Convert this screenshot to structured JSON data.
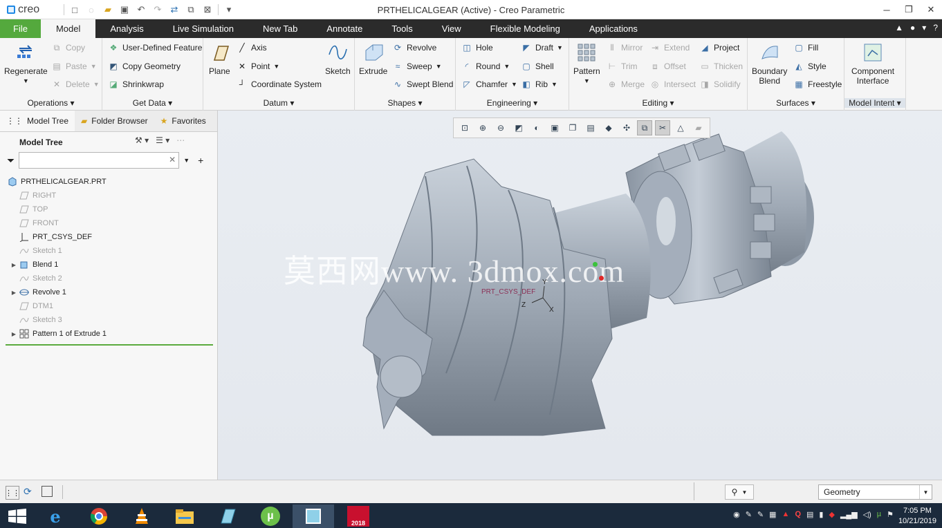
{
  "app": {
    "logo": "creo",
    "window_title": "PRTHELICALGEAR (Active) - Creo Parametric"
  },
  "menu": {
    "file": "File",
    "model": "Model",
    "analysis": "Analysis",
    "live_simulation": "Live Simulation",
    "new_tab": "New Tab",
    "annotate": "Annotate",
    "tools": "Tools",
    "view": "View",
    "flexible_modeling": "Flexible Modeling",
    "applications": "Applications"
  },
  "ribbon": {
    "operations": {
      "regenerate": "Regenerate",
      "copy": "Copy",
      "paste": "Paste",
      "delete": "Delete",
      "label": "Operations"
    },
    "get_data": {
      "udf": "User-Defined Feature",
      "copy_geometry": "Copy Geometry",
      "shrinkwrap": "Shrinkwrap",
      "label": "Get Data"
    },
    "datum": {
      "plane": "Plane",
      "axis": "Axis",
      "point": "Point",
      "csys": "Coordinate System",
      "sketch": "Sketch",
      "label": "Datum"
    },
    "shapes": {
      "extrude": "Extrude",
      "revolve": "Revolve",
      "sweep": "Sweep",
      "swept_blend": "Swept Blend",
      "label": "Shapes"
    },
    "engineering": {
      "hole": "Hole",
      "round": "Round",
      "chamfer": "Chamfer",
      "draft": "Draft",
      "shell": "Shell",
      "rib": "Rib",
      "label": "Engineering"
    },
    "editing": {
      "pattern": "Pattern",
      "mirror": "Mirror",
      "trim": "Trim",
      "merge": "Merge",
      "extend": "Extend",
      "offset": "Offset",
      "intersect": "Intersect",
      "project": "Project",
      "thicken": "Thicken",
      "solidify": "Solidify",
      "label": "Editing"
    },
    "surfaces": {
      "boundary_blend_1": "Boundary",
      "boundary_blend_2": "Blend",
      "fill": "Fill",
      "style": "Style",
      "freestyle": "Freestyle",
      "label": "Surfaces"
    },
    "model_intent": {
      "component_interface_1": "Component",
      "component_interface_2": "Interface",
      "label": "Model Intent"
    }
  },
  "panel": {
    "tabs": {
      "model_tree": "Model Tree",
      "folder_browser": "Folder Browser",
      "favorites": "Favorites"
    },
    "header": "Model Tree",
    "filter_value": "",
    "tree": [
      {
        "label": "PRTHELICALGEAR.PRT",
        "expandable": false,
        "greyed": false,
        "icon": "part-icon"
      },
      {
        "label": "RIGHT",
        "expandable": false,
        "greyed": true,
        "icon": "datum-plane-icon"
      },
      {
        "label": "TOP",
        "expandable": false,
        "greyed": true,
        "icon": "datum-plane-icon"
      },
      {
        "label": "FRONT",
        "expandable": false,
        "greyed": true,
        "icon": "datum-plane-icon"
      },
      {
        "label": "PRT_CSYS_DEF",
        "expandable": false,
        "greyed": false,
        "icon": "csys-icon"
      },
      {
        "label": "Sketch 1",
        "expandable": false,
        "greyed": true,
        "icon": "sketch-icon"
      },
      {
        "label": "Blend 1",
        "expandable": true,
        "greyed": false,
        "icon": "blend-icon"
      },
      {
        "label": "Sketch 2",
        "expandable": false,
        "greyed": true,
        "icon": "sketch-icon"
      },
      {
        "label": "Revolve 1",
        "expandable": true,
        "greyed": false,
        "icon": "revolve-icon"
      },
      {
        "label": "DTM1",
        "expandable": false,
        "greyed": true,
        "icon": "datum-plane-icon"
      },
      {
        "label": "Sketch 3",
        "expandable": false,
        "greyed": true,
        "icon": "sketch-icon"
      },
      {
        "label": "Pattern 1 of Extrude 1",
        "expandable": true,
        "greyed": false,
        "icon": "pattern-icon"
      }
    ]
  },
  "viewport": {
    "watermark": "莫西网www. 3dmox.com",
    "csys_label": "PRT_CSYS_DEF",
    "axis_x": "X",
    "axis_y": "Y",
    "axis_z": "Z"
  },
  "status": {
    "filter_value": "Geometry"
  },
  "taskbar": {
    "time": "7:05 PM",
    "date": "10/21/2019",
    "sw_badge": "2018"
  }
}
